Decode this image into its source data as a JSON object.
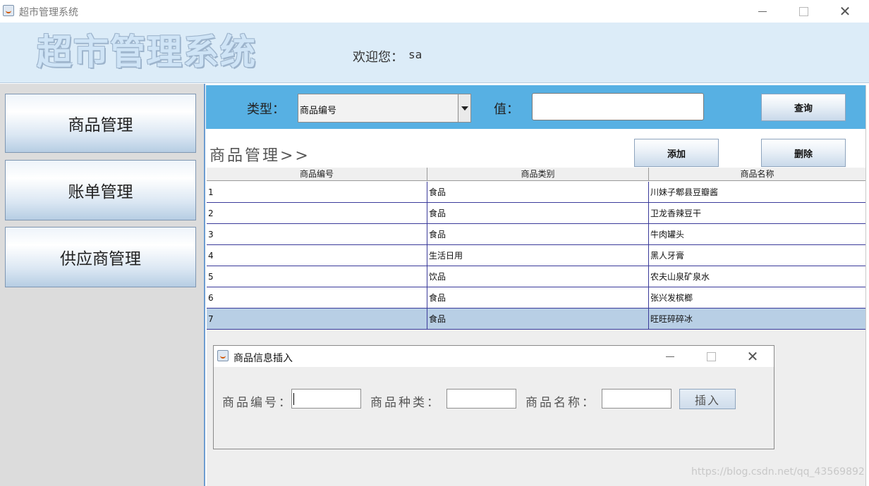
{
  "window": {
    "title": "超市管理系统"
  },
  "header": {
    "logo_text": "超市管理系统",
    "welcome_label": "欢迎您：",
    "username": "sa"
  },
  "sidebar": {
    "items": [
      {
        "label": "商品管理"
      },
      {
        "label": "账单管理"
      },
      {
        "label": "供应商管理"
      }
    ]
  },
  "query": {
    "type_label": "类型：",
    "type_selected": "商品编号",
    "value_label": "值：",
    "value_input": "",
    "search_label": "查询"
  },
  "goods": {
    "title": "商品管理>>",
    "add_label": "添加",
    "delete_label": "删除",
    "columns": [
      "商品编号",
      "商品类别",
      "商品名称"
    ],
    "rows": [
      [
        "1",
        "食品",
        "川妹子郫县豆瓣酱"
      ],
      [
        "2",
        "食品",
        "卫龙香辣豆干"
      ],
      [
        "3",
        "食品",
        "牛肉罐头"
      ],
      [
        "4",
        "生活日用",
        "黑人牙膏"
      ],
      [
        "5",
        "饮品",
        "农夫山泉矿泉水"
      ],
      [
        "6",
        "食品",
        "张兴发槟榔"
      ],
      [
        "7",
        "食品",
        "旺旺碎碎冰"
      ]
    ],
    "selected_row": 7
  },
  "dialog": {
    "title": "商品信息插入",
    "id_label": "商品编号：",
    "category_label": "商品种类：",
    "name_label": "商品名称：",
    "insert_label": "插入"
  },
  "watermark": "https://blog.csdn.net/qq_43569892"
}
